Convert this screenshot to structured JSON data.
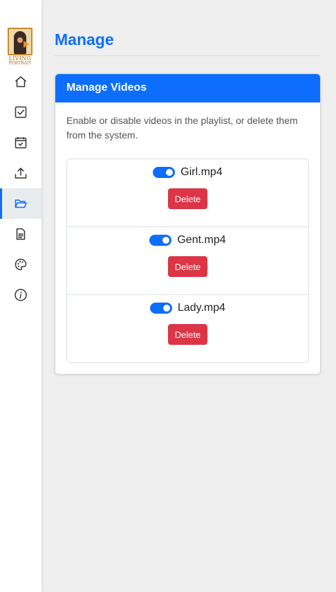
{
  "brand": {
    "line1": "LIVING",
    "line2": "PORTRAIT"
  },
  "nav": [
    {
      "icon": "home-icon",
      "name": "nav-home"
    },
    {
      "icon": "check-square-icon",
      "name": "nav-tasks"
    },
    {
      "icon": "calendar-check-icon",
      "name": "nav-schedule"
    },
    {
      "icon": "upload-icon",
      "name": "nav-upload"
    },
    {
      "icon": "folder-open-icon",
      "name": "nav-manage",
      "active": true
    },
    {
      "icon": "document-icon",
      "name": "nav-logs"
    },
    {
      "icon": "palette-icon",
      "name": "nav-theme"
    },
    {
      "icon": "info-icon",
      "name": "nav-about"
    }
  ],
  "page": {
    "title": "Manage"
  },
  "card": {
    "header": "Manage Videos",
    "description": "Enable or disable videos in the playlist, or delete them from the system."
  },
  "videos": [
    {
      "name": "Girl.mp4",
      "enabled": true,
      "delete_label": "Delete"
    },
    {
      "name": "Gent.mp4",
      "enabled": true,
      "delete_label": "Delete"
    },
    {
      "name": "Lady.mp4",
      "enabled": true,
      "delete_label": "Delete"
    }
  ],
  "colors": {
    "accent": "#0d6efd",
    "danger": "#dc3545",
    "background": "#efefef"
  }
}
